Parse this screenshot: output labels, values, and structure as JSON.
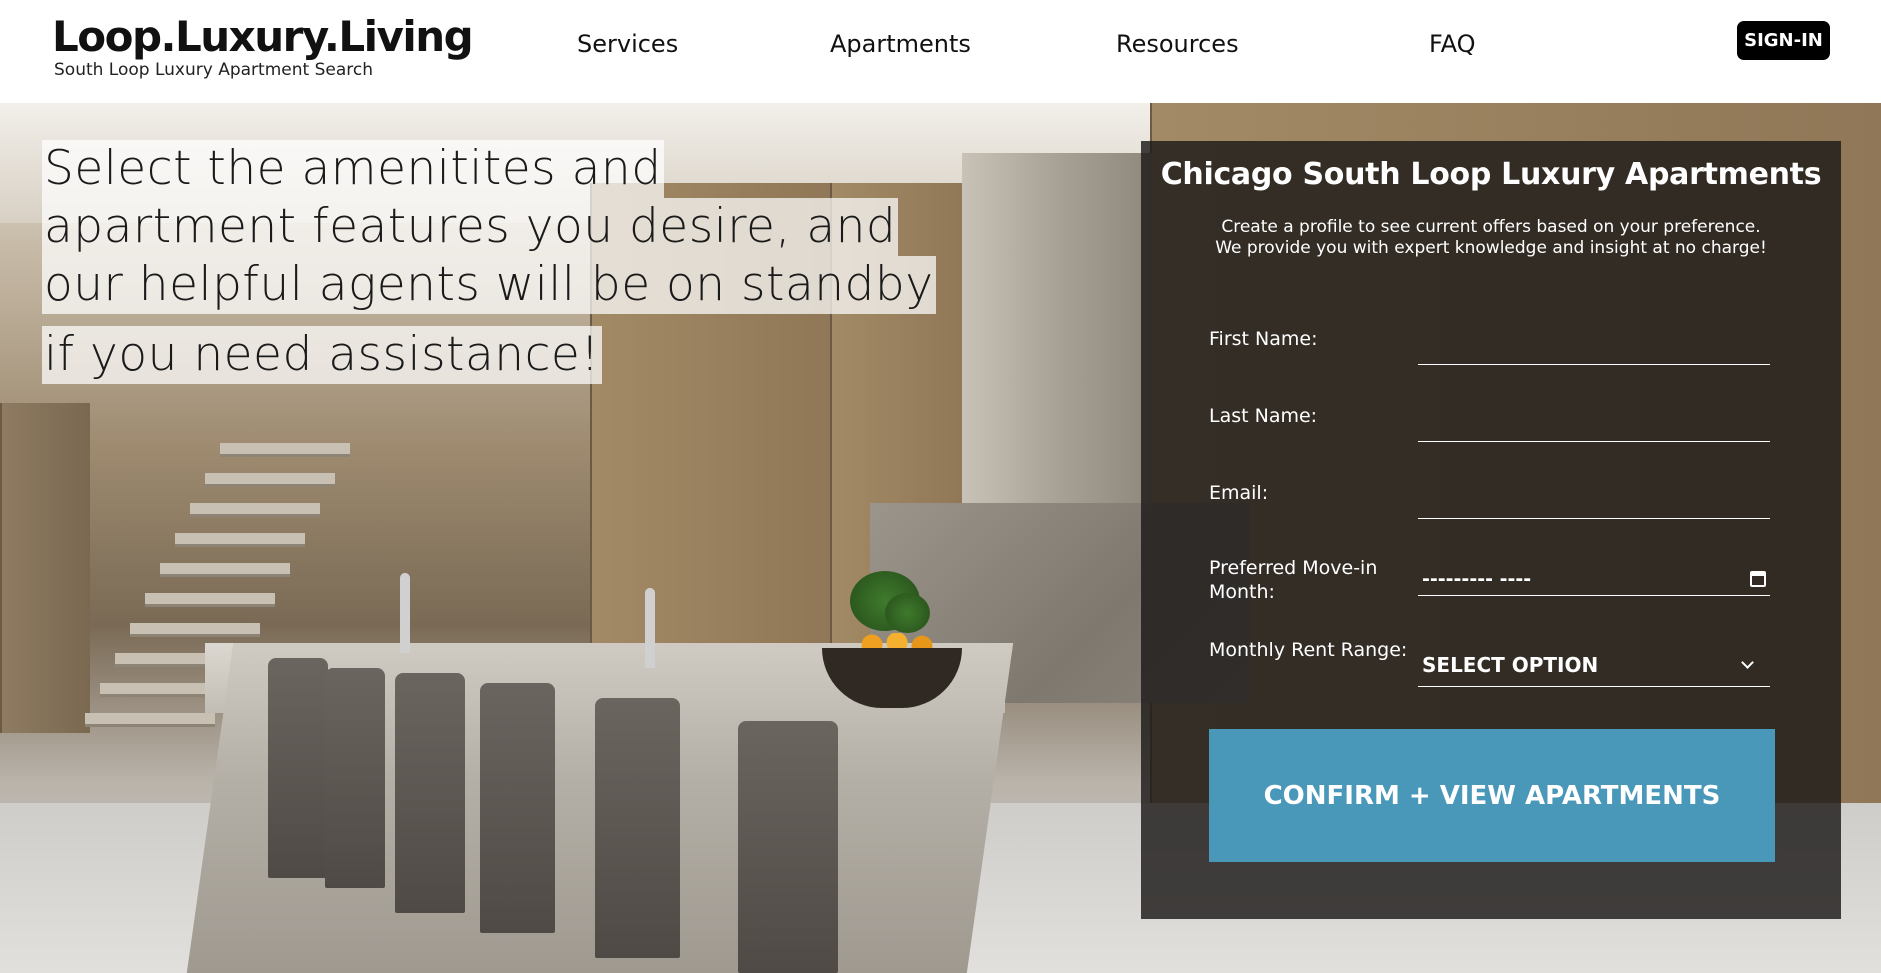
{
  "header": {
    "logo_title": "Loop.Luxury.Living",
    "logo_subtitle": "South Loop Luxury Apartment Search",
    "nav": [
      "Services",
      "Apartments",
      "Resources",
      "FAQ"
    ],
    "signin_label": "SIGN-IN"
  },
  "hero": {
    "headline_lines": [
      "Select the amenitites and",
      "apartment features you desire, and",
      "our helpful agents will be on standby",
      "if you need assistance!"
    ]
  },
  "form": {
    "title": "Chicago South Loop Luxury Apartments",
    "description": "Create a profile to see current offers based on your preference. We provide you with expert knowledge and insight at no charge!",
    "first_name_label": "First Name:",
    "last_name_label": "Last Name:",
    "email_label": "Email:",
    "move_in_label": "Preferred Move-in Month:",
    "move_in_value": "--------- ----",
    "rent_label": "Monthly Rent Range:",
    "rent_value": "SELECT OPTION",
    "confirm_label": "CONFIRM + VIEW APARTMENTS"
  },
  "icons": {
    "calendar": "calendar-icon",
    "chevron": "chevron-down-icon"
  }
}
